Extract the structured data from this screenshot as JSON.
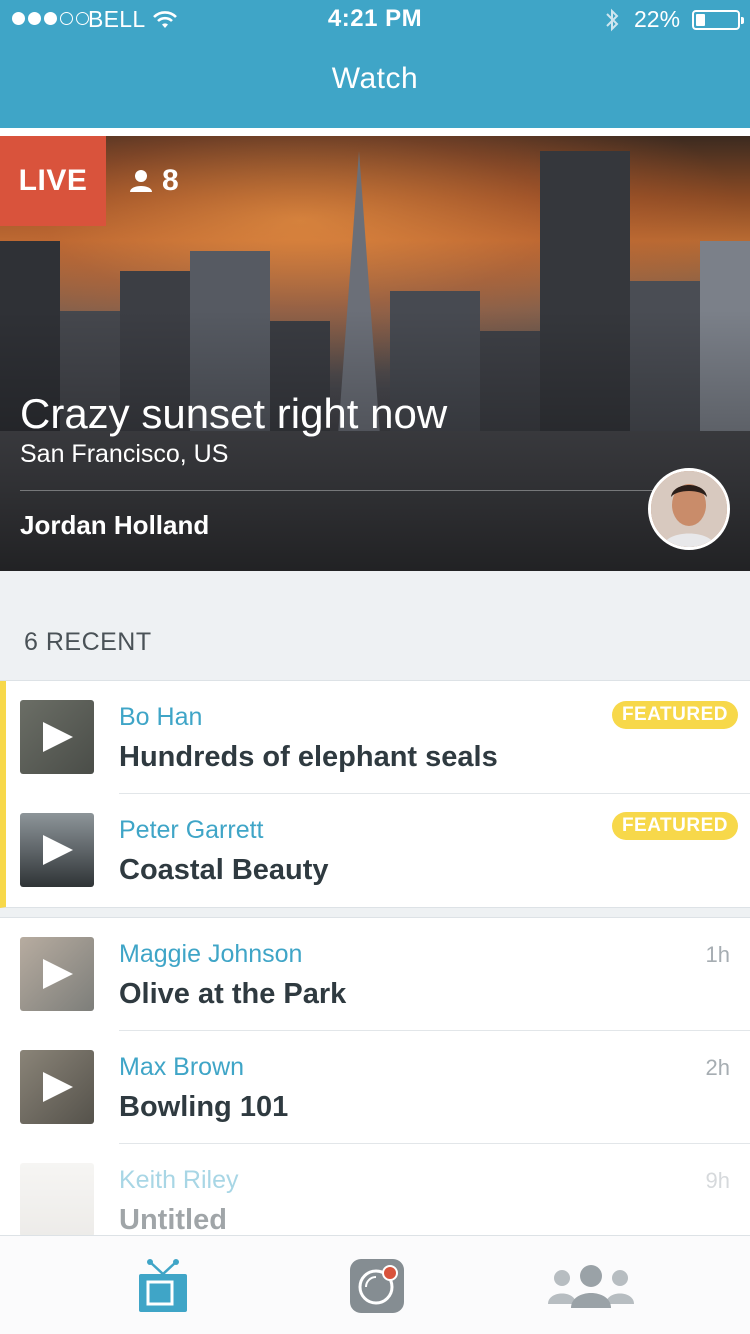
{
  "status_bar": {
    "carrier": "BELL",
    "time": "4:21 PM",
    "battery": "22%",
    "battery_level": 0.22,
    "signal_bars": 3
  },
  "nav": {
    "title": "Watch"
  },
  "live_stream": {
    "badge": "LIVE",
    "viewers": "8",
    "title": "Crazy sunset right now",
    "location": "San Francisco, US",
    "author": "Jordan Holland"
  },
  "recent": {
    "header": "6 RECENT",
    "featured_badge": "FEATURED",
    "featured": [
      {
        "author": "Bo Han",
        "title": "Hundreds of elephant seals",
        "badge": "FEATURED"
      },
      {
        "author": "Peter Garrett",
        "title": "Coastal Beauty",
        "badge": "FEATURED"
      }
    ],
    "items": [
      {
        "author": "Maggie Johnson",
        "title": "Olive at the Park",
        "age": "1h"
      },
      {
        "author": "Max Brown",
        "title": "Bowling 101",
        "age": "2h"
      },
      {
        "author": "Keith Riley",
        "title": "Untitled",
        "age": "9h"
      }
    ]
  },
  "tabs": [
    {
      "icon": "tv-icon",
      "active": true
    },
    {
      "icon": "camera-record-icon",
      "active": false
    },
    {
      "icon": "people-icon",
      "active": false
    }
  ],
  "colors": {
    "accent": "#3fa5c7",
    "live": "#d9533c",
    "featured": "#f7d84a",
    "text_dark": "#2f3a40",
    "muted": "#a6adb2"
  }
}
